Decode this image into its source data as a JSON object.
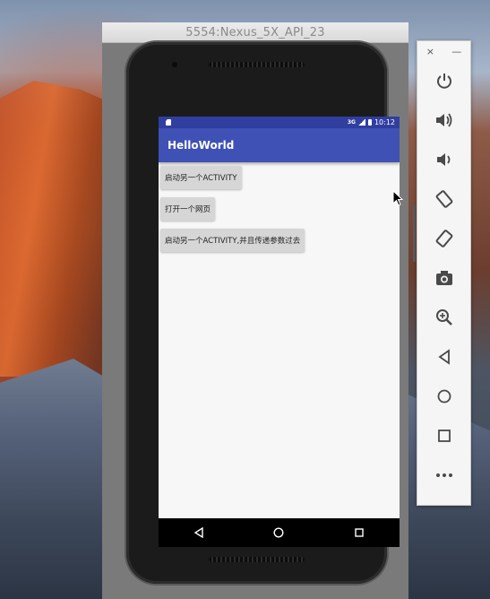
{
  "emulator": {
    "window_title": "5554:Nexus_5X_API_23"
  },
  "status_bar": {
    "network": "3G",
    "time": "10:12"
  },
  "app": {
    "title": "HelloWorld",
    "buttons": [
      {
        "label": "启动另一个ACTIVITY"
      },
      {
        "label": "打开一个网页"
      },
      {
        "label": "启动另一个ACTIVITY,并且传递参数过去"
      }
    ]
  },
  "toolbar": {
    "close_label": "×",
    "minimize_label": "—",
    "items": [
      "power",
      "volume-up",
      "volume-down",
      "rotate-left",
      "rotate-right",
      "screenshot",
      "zoom",
      "back",
      "home",
      "overview",
      "more"
    ]
  },
  "colors": {
    "primary": "#3f51b5",
    "primary_dark": "#303f9f"
  }
}
